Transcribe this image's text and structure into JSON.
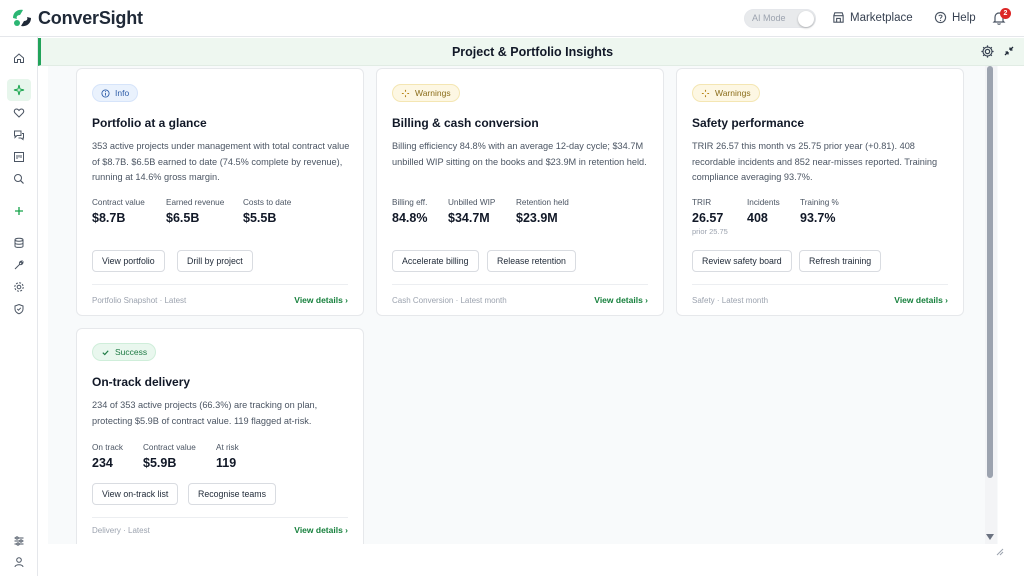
{
  "app": {
    "name": "ConverSight"
  },
  "topbar": {
    "ai_mode": "AI Mode",
    "marketplace": "Marketplace",
    "help": "Help",
    "notifications": "2"
  },
  "sidebar": {
    "icons": [
      "home-icon",
      "sparkle-icon",
      "heart-icon",
      "chat-icon",
      "board-icon",
      "zoom-icon",
      "plus-icon",
      "database-icon",
      "wrench-icon",
      "settings-icon",
      "shield-icon",
      "sliders-icon",
      "user-icon"
    ]
  },
  "header": {
    "title": "Project & Portfolio Insights"
  },
  "colors": {
    "accent": "#22a35a",
    "link": "#16803c",
    "info": "#2f5ea8",
    "warning": "#8a6d1a",
    "success": "#1e7a44"
  },
  "cards": [
    {
      "badge": "Info",
      "title": "Portfolio at a glance",
      "description": "353 active projects under management with total contract value of $8.7B. $6.5B earned to date (74.5% complete by revenue), running at 14.6% gross margin.",
      "metrics": [
        {
          "label": "Contract value",
          "value": "$8.7B"
        },
        {
          "label": "Earned revenue",
          "value": "$6.5B"
        },
        {
          "label": "Costs to date",
          "value": "$5.5B"
        }
      ],
      "buttons": [
        "View portfolio",
        "Drill by project"
      ],
      "footnote": "Portfolio Snapshot · Latest",
      "link": "View details ›"
    },
    {
      "badge": "Warnings",
      "title": "Billing & cash conversion",
      "description": "Billing efficiency 84.8% with an average 12-day cycle; $34.7M unbilled WIP sitting on the books and $23.9M in retention held.",
      "metrics": [
        {
          "label": "Billing eff.",
          "value": "84.8%"
        },
        {
          "label": "Unbilled WIP",
          "value": "$34.7M"
        },
        {
          "label": "Retention held",
          "value": "$23.9M"
        }
      ],
      "buttons": [
        "Accelerate billing",
        "Release retention"
      ],
      "footnote": "Cash Conversion · Latest month",
      "link": "View details ›"
    },
    {
      "badge": "Warnings",
      "title": "Safety performance",
      "description": "TRIR 26.57 this month vs 25.75 prior year (+0.81). 408 recordable incidents and 852 near-misses reported. Training compliance averaging 93.7%.",
      "metrics": [
        {
          "label": "TRIR",
          "value": "26.57",
          "sub": "prior 25.75"
        },
        {
          "label": "Incidents",
          "value": "408"
        },
        {
          "label": "Training %",
          "value": "93.7%"
        }
      ],
      "buttons": [
        "Review safety board",
        "Refresh training"
      ],
      "footnote": "Safety · Latest month",
      "link": "View details ›"
    },
    {
      "badge": "Success",
      "title": "On-track delivery",
      "description": "234 of 353 active projects (66.3%) are tracking on plan, protecting $5.9B of contract value. 119 flagged at-risk.",
      "metrics": [
        {
          "label": "On track",
          "value": "234"
        },
        {
          "label": "Contract value",
          "value": "$5.9B"
        },
        {
          "label": "At risk",
          "value": "119"
        }
      ],
      "buttons": [
        "View on-track list",
        "Recognise teams"
      ],
      "footnote": "Delivery · Latest",
      "link": "View details ›"
    }
  ]
}
